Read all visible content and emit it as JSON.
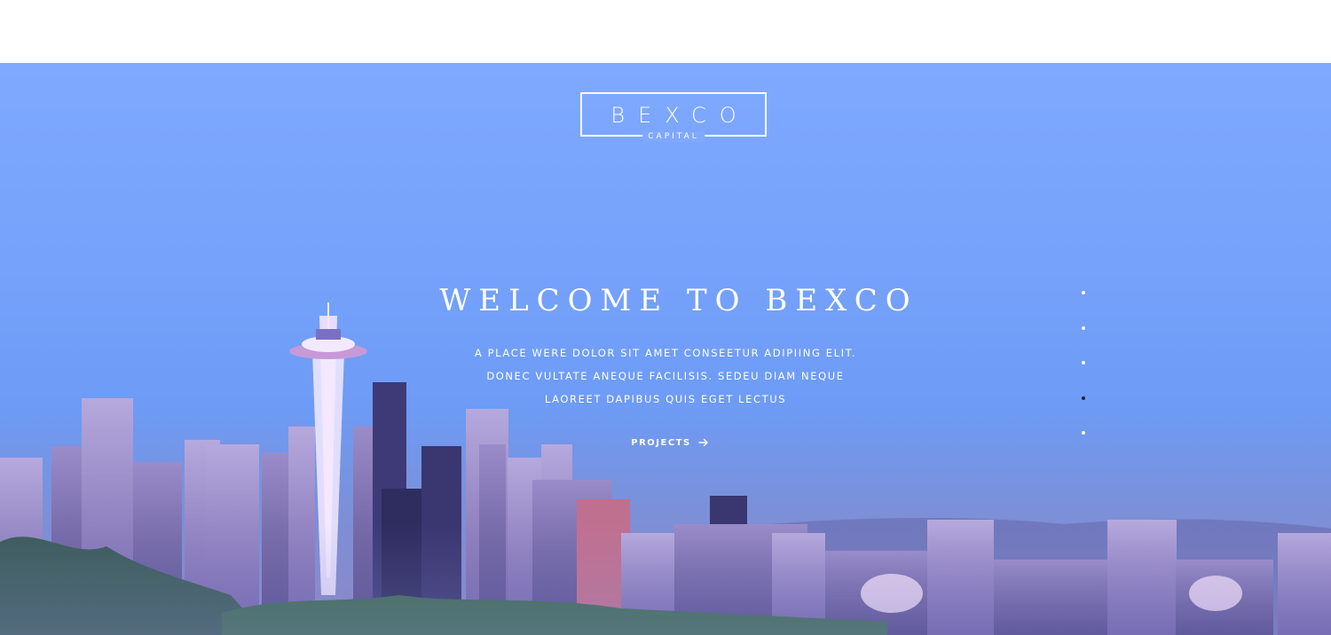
{
  "logo": {
    "main": "BEXCO",
    "sub": "CAPITAL"
  },
  "hero": {
    "title": "WELCOME TO BEXCO",
    "tagline_lines": [
      "A PLACE WERE DOLOR SIT AMET CONSEETUR ADIPIING ELIT.",
      "DONEC VULTATE ANEQUE FACILISIS. SEDEU DIAM NEQUE",
      "LAOREET DAPIBUS QUIS EGET LECTUS"
    ],
    "cta_label": "PROJECTS",
    "cta_icon": "arrow-right-icon"
  },
  "slider": {
    "count": 5,
    "active_index": 3
  },
  "colors": {
    "sky_top": "#7fa9ff",
    "text": "#ffffff",
    "active_dot": "#1d2340"
  }
}
